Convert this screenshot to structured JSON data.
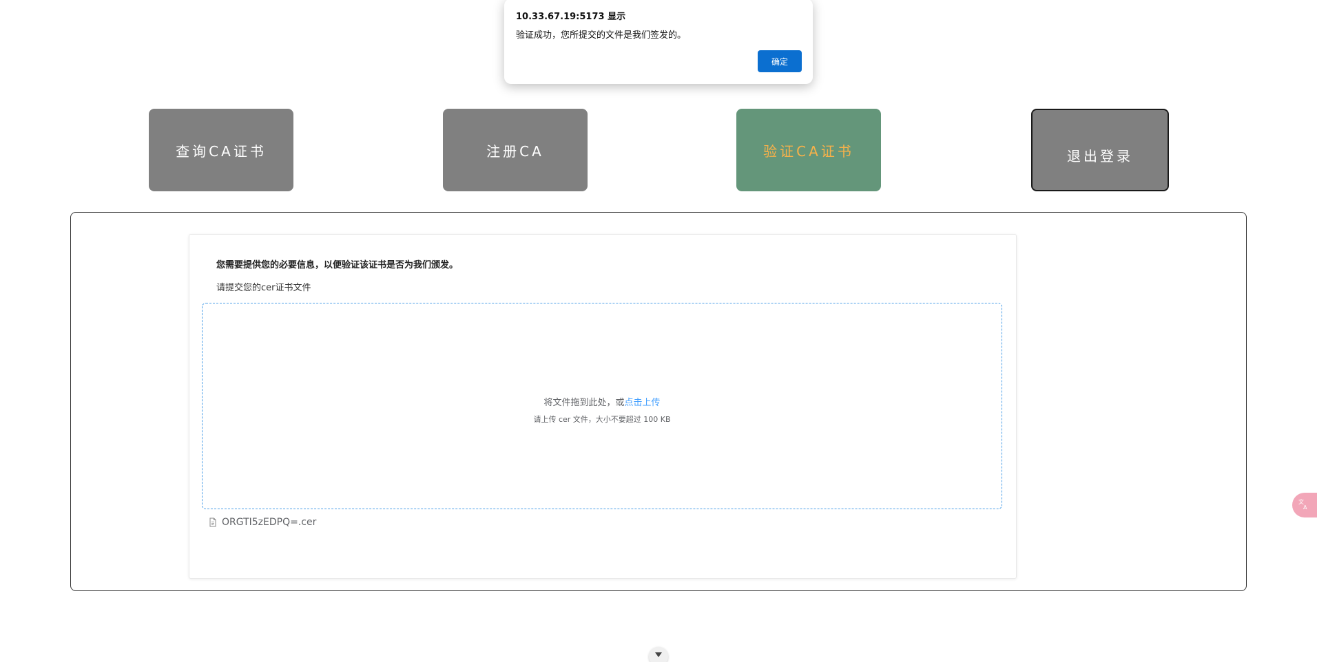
{
  "nav": {
    "query_label": "查询CA证书",
    "register_label": "注册CA",
    "verify_label": "验证CA证书",
    "logout_label": "退出登录"
  },
  "card": {
    "title": "您需要提供您的必要信息，以便验证该证书是否为我们颁发。",
    "subtitle": "请提交您的cer证书文件"
  },
  "upload": {
    "drag_text": "将文件拖到此处，或",
    "click_text": "点击上传",
    "tip": "请上传 cer 文件，大小不要超过 100 KB",
    "file_name": "ORGTI5zEDPQ=.cer"
  },
  "dialog": {
    "title": "10.33.67.19:5173 显示",
    "message": "验证成功，您所提交的文件是我们签发的。",
    "ok_label": "确定"
  },
  "colors": {
    "nav_default": "#808080",
    "nav_active_bg": "#64967a",
    "nav_active_text": "#f7b14a",
    "link": "#409eff",
    "dialog_button": "#0b6fd0"
  },
  "icons": {
    "file": "document-icon",
    "side": "translate-icon",
    "scroll": "chevron-down-icon"
  }
}
